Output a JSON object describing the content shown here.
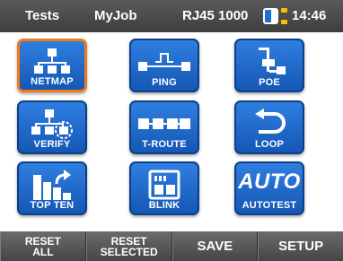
{
  "status_bar": {
    "tests_label": "Tests",
    "job_label": "MyJob",
    "link_status": "RJ45 1000",
    "battery_level": 0.55,
    "time": "14:46"
  },
  "tiles": [
    {
      "label": "NETMAP",
      "icon": "netmap-icon",
      "selected": true
    },
    {
      "label": "PING",
      "icon": "ping-icon",
      "selected": false
    },
    {
      "label": "POE",
      "icon": "poe-icon",
      "selected": false
    },
    {
      "label": "VERIFY",
      "icon": "verify-icon",
      "selected": false
    },
    {
      "label": "T-ROUTE",
      "icon": "traceroute-icon",
      "selected": false
    },
    {
      "label": "LOOP",
      "icon": "loop-icon",
      "selected": false
    },
    {
      "label": "TOP TEN",
      "icon": "top-ten-icon",
      "selected": false
    },
    {
      "label": "BLINK",
      "icon": "blink-icon",
      "selected": false
    },
    {
      "label": "AUTOTEST",
      "big_text": "AUTO",
      "icon": "autotest-icon",
      "selected": false
    }
  ],
  "softkeys": {
    "reset_all_line1": "RESET",
    "reset_all_line2": "ALL",
    "reset_selected_line1": "RESET",
    "reset_selected_line2": "SELECTED",
    "save": "SAVE",
    "setup": "SETUP"
  },
  "colors": {
    "tile_blue": "#1f6fd1",
    "selected_border": "#f07a1e",
    "status_bar": "#4a4a4a"
  }
}
